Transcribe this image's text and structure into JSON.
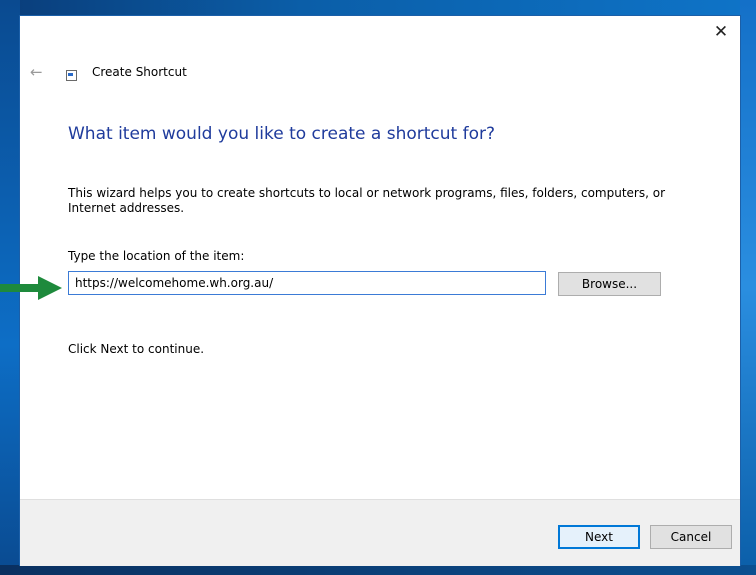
{
  "window": {
    "title": "Create Shortcut",
    "close_glyph": "✕",
    "back_glyph": "←",
    "back_icon": "back-arrow-icon",
    "title_icon": "shortcut-icon"
  },
  "wizard": {
    "heading": "What item would you like to create a shortcut for?",
    "description": "This wizard helps you to create shortcuts to local or network programs, files, folders, computers, or Internet addresses.",
    "location_label": "Type the location of the item:",
    "location_value": "https://welcomehome.wh.org.au/",
    "browse_label": "Browse...",
    "continue_text": "Click Next to continue."
  },
  "footer": {
    "next_label": "Next",
    "cancel_label": "Cancel"
  },
  "colors": {
    "heading": "#1f3b9c",
    "annotation_arrow": "#1e8a3c",
    "input_border_focus": "#3b7bd6",
    "default_button_border": "#0078d7"
  }
}
